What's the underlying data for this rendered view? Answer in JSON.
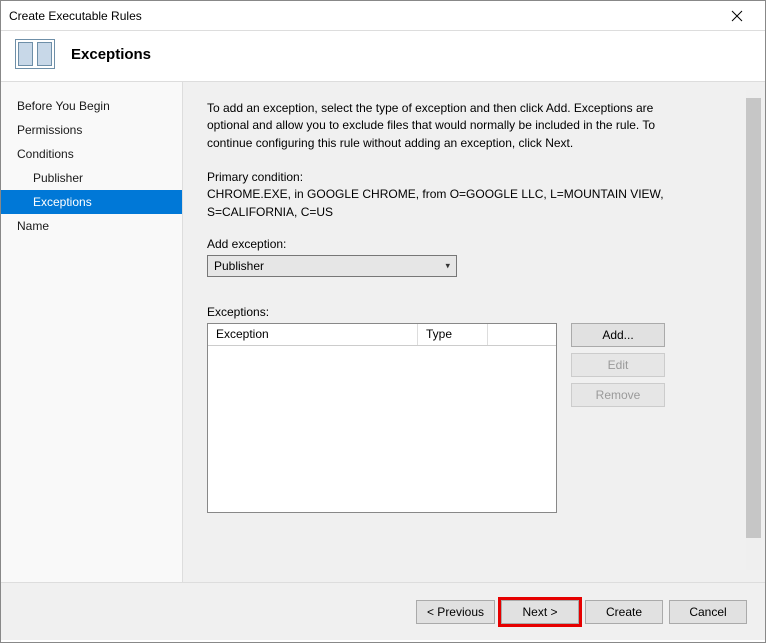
{
  "window": {
    "title": "Create Executable Rules",
    "page_title": "Exceptions"
  },
  "sidebar": {
    "items": [
      {
        "label": "Before You Begin",
        "child": false,
        "selected": false
      },
      {
        "label": "Permissions",
        "child": false,
        "selected": false
      },
      {
        "label": "Conditions",
        "child": false,
        "selected": false
      },
      {
        "label": "Publisher",
        "child": true,
        "selected": false
      },
      {
        "label": "Exceptions",
        "child": true,
        "selected": true
      },
      {
        "label": "Name",
        "child": false,
        "selected": false
      }
    ]
  },
  "content": {
    "description": "To add an exception, select the type of exception and then click Add. Exceptions are optional and allow you to exclude files that would normally be included in the rule. To continue configuring this rule without adding an exception, click Next.",
    "primary_label": "Primary condition:",
    "primary_value": "CHROME.EXE, in GOOGLE CHROME, from O=GOOGLE LLC, L=MOUNTAIN VIEW, S=CALIFORNIA, C=US",
    "add_label": "Add exception:",
    "combo_value": "Publisher",
    "exceptions_label": "Exceptions:",
    "table": {
      "col1": "Exception",
      "col2": "Type"
    },
    "side_buttons": {
      "add": "Add...",
      "edit": "Edit",
      "remove": "Remove"
    }
  },
  "footer": {
    "previous": "< Previous",
    "next": "Next >",
    "create": "Create",
    "cancel": "Cancel"
  }
}
